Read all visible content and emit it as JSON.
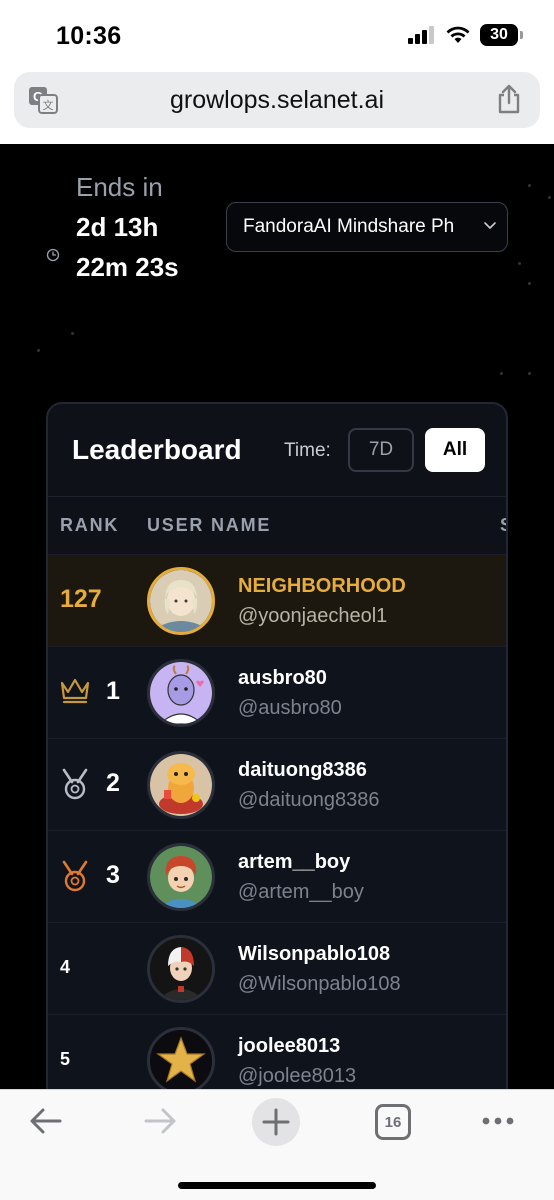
{
  "status_bar": {
    "time": "10:36",
    "battery": "30"
  },
  "browser": {
    "url": "growlops.selanet.ai",
    "tab_count": "16"
  },
  "countdown": {
    "label": "Ends in",
    "line1": "2d 13h",
    "line2": "22m 23s"
  },
  "campaign_select": {
    "value": "FandoraAI Mindshare Ph"
  },
  "leaderboard": {
    "title": "Leaderboard",
    "time_label": "Time:",
    "time_options": [
      "7D",
      "All"
    ],
    "selected_time": "All",
    "columns": [
      "RANK",
      "USER NAME",
      "S"
    ],
    "rows": [
      {
        "rank": "127",
        "name": "NEIGHBORHOOD",
        "handle": "@yoonjaecheol1",
        "current_user": true
      },
      {
        "rank": "1",
        "name": "ausbro80",
        "handle": "@ausbro80",
        "medal": "crown-icon"
      },
      {
        "rank": "2",
        "name": "daituong8386",
        "handle": "@daituong8386",
        "medal": "silver-medal-icon"
      },
      {
        "rank": "3",
        "name": "artem__boy",
        "handle": "@artem__boy",
        "medal": "bronze-medal-icon"
      },
      {
        "rank": "4",
        "name": "Wilsonpablo108",
        "handle": "@Wilsonpablo108"
      },
      {
        "rank": "5",
        "name": "joolee8013",
        "handle": "@joolee8013"
      }
    ]
  },
  "colors": {
    "accent_gold": "#e6ad3b",
    "bronze": "#e07a2e",
    "silver": "#b8bcc6",
    "background": "#000000",
    "card": "#0e1118"
  }
}
